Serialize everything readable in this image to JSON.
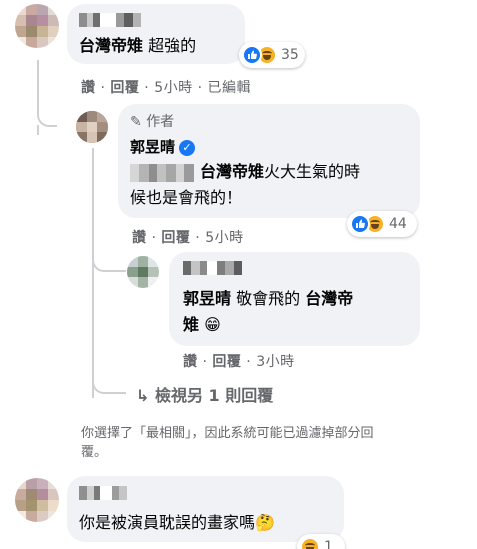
{
  "colors": {
    "link_blue": "#1877f2",
    "bubble_bg": "#f0f2f5",
    "meta_gray": "#65676b",
    "haha_yellow": "#f7b125"
  },
  "comment1": {
    "mention": "台灣帝雉",
    "text": "超強的",
    "reactions": {
      "icons": [
        "like-icon",
        "haha-icon"
      ],
      "count": "35"
    },
    "actions": {
      "like": "讚",
      "reply": "回覆",
      "time": "5小時",
      "edited": "已編輯"
    }
  },
  "reply1": {
    "author_label": "作者",
    "author_name": "郭昱晴",
    "verified": "✓",
    "mention": "台灣帝雉",
    "text_line1": "火大生氣的時",
    "text_line2": "候也是會飛的！",
    "reactions": {
      "icons": [
        "like-icon",
        "haha-icon"
      ],
      "count": "44"
    },
    "actions": {
      "like": "讚",
      "reply": "回覆",
      "time": "5小時"
    }
  },
  "reply2": {
    "mention1": "郭昱晴",
    "text": "敬會飛的",
    "mention2": "台灣帝",
    "mention2_line2": "雉",
    "emoji": "😁",
    "actions": {
      "like": "讚",
      "reply": "回覆",
      "time": "3小時"
    }
  },
  "view_more": {
    "label": "檢視另 1 則回覆"
  },
  "filter_notice": {
    "line1": "你選擇了「最相關」，因此系統可能已過濾掉部分回",
    "line2": "覆。"
  },
  "comment2": {
    "text": "你是被演員耽誤的畫家嗎",
    "emoji": "🤔",
    "reactions": {
      "icons": [
        "haha-icon"
      ],
      "count": "1"
    }
  }
}
